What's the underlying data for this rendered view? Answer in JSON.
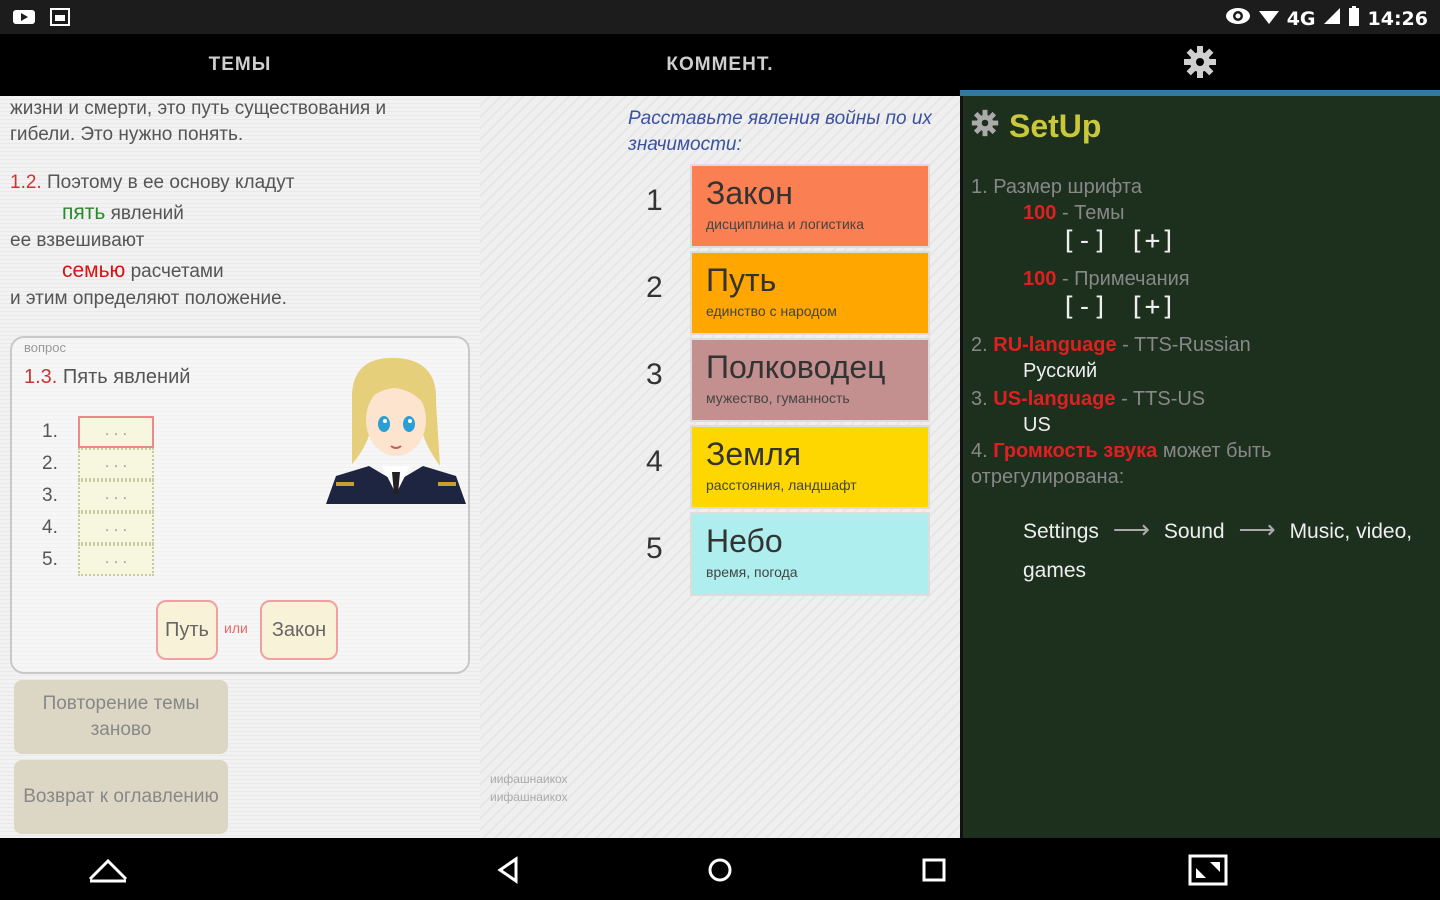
{
  "status_bar": {
    "network": "4G",
    "time": "14:26"
  },
  "tabs": {
    "topics": "ТЕМЫ",
    "comment": "КОММЕНТ."
  },
  "left": {
    "para1_line1": "жизни и смерти, это путь существования и",
    "para1_line2": "гибели. Это нужно понять.",
    "num_12": "1.2.",
    "line_12a": "Поэтому в ее основу кладут",
    "five": "пять",
    "phenomena": "явлений",
    "weigh": "ее взвешивают",
    "seven": "семью",
    "calcs": "расчетами",
    "determine": "и этим определяют положение.",
    "question": {
      "small_label": "вопрос",
      "num": "1.3.",
      "title": "Пять явлений",
      "slots": [
        "1.",
        "2.",
        "3.",
        "4.",
        "5."
      ],
      "slot_placeholder": ". . .",
      "choice_a": "Путь",
      "or": "или",
      "choice_b": "Закон"
    },
    "btn_repeat": "Повторение темы заново",
    "btn_back": "Возврат к оглавлению"
  },
  "middle": {
    "instruction": "Расставьте явления войны по их значимости:",
    "items": [
      {
        "num": "1",
        "title": "Закон",
        "sub": "дисциплина и логистика",
        "color": "#fa7f52"
      },
      {
        "num": "2",
        "title": "Путь",
        "sub": "единство с народом",
        "color": "#ffa600"
      },
      {
        "num": "3",
        "title": "Полководец",
        "sub": "мужество, гуманность",
        "color": "#c48f8f"
      },
      {
        "num": "4",
        "title": "Земля",
        "sub": "расстояния, ландшафт",
        "color": "#ffd700"
      },
      {
        "num": "5",
        "title": "Небо",
        "sub": "время, погода",
        "color": "#aeeeee"
      }
    ],
    "small1": "иифашнаикох",
    "small2": "иифашнаикох"
  },
  "right": {
    "title": "SetUp",
    "item1": "1. Размер шрифта",
    "size1": "100",
    "label1": "- Темы",
    "size2": "100",
    "label2": "- Примечания",
    "minus": "[-]",
    "plus": "[+]",
    "item2_num": "2.",
    "item2_lang": "RU-language",
    "item2_tts": "- TTS-Russian",
    "item2_value": "Русский",
    "item3_num": "3.",
    "item3_lang": "US-language",
    "item3_tts": "- TTS-US",
    "item3_value": "US",
    "item4_num": "4.",
    "item4_red": "Громкость звука",
    "item4_rest": "может быть",
    "item4_line2": "отрегулирована:",
    "path1": "Settings",
    "path2": "Sound",
    "path3": "Music, video,",
    "path4": "games"
  }
}
